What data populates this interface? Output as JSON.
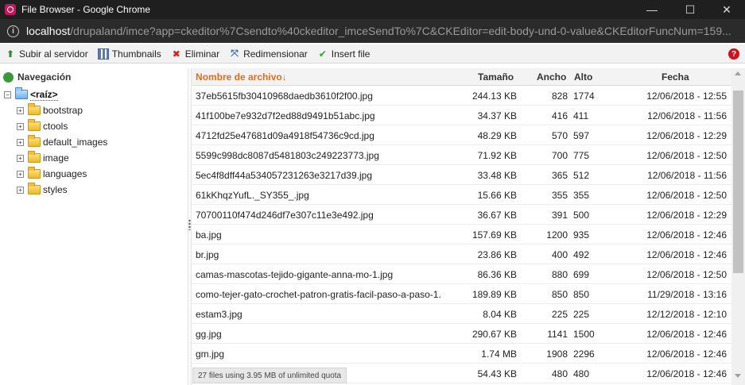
{
  "window": {
    "title": "File Browser - Google Chrome",
    "min_glyph": "—",
    "max_glyph": "☐",
    "close_glyph": "✕"
  },
  "address": {
    "host": "localhost",
    "path": "/drupaland/imce?app=ckeditor%7Csendto%40ckeditor_imceSendTo%7C&CKEditor=edit-body-und-0-value&CKEditorFuncNum=159..."
  },
  "toolbar": {
    "upload_label": "Subir al servidor",
    "thumbnails_label": "Thumbnails",
    "delete_label": "Eliminar",
    "resize_label": "Redimensionar",
    "insert_label": "Insert file",
    "help_glyph": "?"
  },
  "nav": {
    "title": "Navegación",
    "root_label": "<raíz>",
    "folders": [
      "bootstrap",
      "ctools",
      "default_images",
      "image",
      "languages",
      "styles"
    ]
  },
  "list": {
    "headers": {
      "name": "Nombre de archivo↓",
      "size": "Tamaño",
      "width": "Ancho",
      "height": "Alto",
      "date": "Fecha"
    },
    "rows": [
      {
        "name": "37eb5615fb30410968daedb3610f2f00.jpg",
        "size": "244.13 KB",
        "width": "828",
        "height": "1774",
        "date": "12/06/2018 - 12:55"
      },
      {
        "name": "41f100be7e932d7f2ed88d9491b51abc.jpg",
        "size": "34.37 KB",
        "width": "416",
        "height": "411",
        "date": "12/06/2018 - 11:56"
      },
      {
        "name": "4712fd25e47681d09a4918f54736c9cd.jpg",
        "size": "48.29 KB",
        "width": "570",
        "height": "597",
        "date": "12/06/2018 - 12:29"
      },
      {
        "name": "5599c998dc8087d5481803c249223773.jpg",
        "size": "71.92 KB",
        "width": "700",
        "height": "775",
        "date": "12/06/2018 - 12:50"
      },
      {
        "name": "5ec4f8dff44a534057231263e3217d39.jpg",
        "size": "33.48 KB",
        "width": "365",
        "height": "512",
        "date": "12/06/2018 - 11:56"
      },
      {
        "name": "61kKhqzYufL._SY355_.jpg",
        "size": "15.66 KB",
        "width": "355",
        "height": "355",
        "date": "12/06/2018 - 12:50"
      },
      {
        "name": "70700110f474d246df7e307c11e3e492.jpg",
        "size": "36.67 KB",
        "width": "391",
        "height": "500",
        "date": "12/06/2018 - 12:29"
      },
      {
        "name": "ba.jpg",
        "size": "157.69 KB",
        "width": "1200",
        "height": "935",
        "date": "12/06/2018 - 12:46"
      },
      {
        "name": "br.jpg",
        "size": "23.86 KB",
        "width": "400",
        "height": "492",
        "date": "12/06/2018 - 12:46"
      },
      {
        "name": "camas-mascotas-tejido-gigante-anna-mo-1.jpg",
        "size": "86.36 KB",
        "width": "880",
        "height": "699",
        "date": "12/06/2018 - 12:50"
      },
      {
        "name": "como-tejer-gato-crochet-patron-gratis-facil-paso-a-paso-1.",
        "size": "189.89 KB",
        "width": "850",
        "height": "850",
        "date": "11/29/2018 - 13:16"
      },
      {
        "name": "estam3.jpg",
        "size": "8.04 KB",
        "width": "225",
        "height": "225",
        "date": "12/12/2018 - 12:10"
      },
      {
        "name": "gg.jpg",
        "size": "290.67 KB",
        "width": "1141",
        "height": "1500",
        "date": "12/06/2018 - 12:46"
      },
      {
        "name": "gm.jpg",
        "size": "1.74 MB",
        "width": "1908",
        "height": "2296",
        "date": "12/06/2018 - 12:46"
      },
      {
        "name": "",
        "size": "54.43 KB",
        "width": "480",
        "height": "480",
        "date": "12/06/2018 - 12:46"
      }
    ]
  },
  "status": {
    "text": "27 files using 3.95 MB of unlimited quota"
  },
  "colors": {
    "titlebar": "#1f1f1f",
    "addressbar": "#2b2b2b",
    "sort_header": "#e36b1b",
    "help": "#d0101a"
  }
}
